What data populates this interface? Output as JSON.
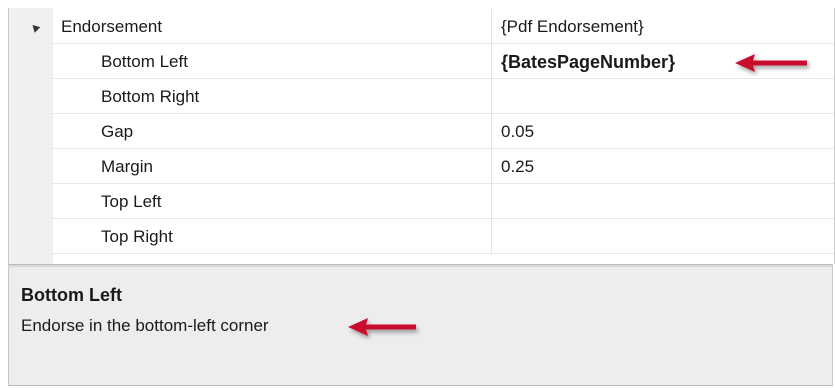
{
  "properties": {
    "category": {
      "label": "Endorsement",
      "value": "{Pdf Endorsement}",
      "expanded": true
    },
    "items": [
      {
        "label": "Bottom Left",
        "value": "{BatesPageNumber}",
        "bold": true
      },
      {
        "label": "Bottom Right",
        "value": ""
      },
      {
        "label": "Gap",
        "value": "0.05"
      },
      {
        "label": "Margin",
        "value": "0.25"
      },
      {
        "label": "Top Left",
        "value": ""
      },
      {
        "label": "Top Right",
        "value": ""
      }
    ]
  },
  "description": {
    "title": "Bottom Left",
    "text": "Endorse in the bottom-left corner"
  },
  "colors": {
    "annotation_arrow": "#c8102e",
    "description_background": "#ededed",
    "gutter_background": "#f0f0f0"
  },
  "icons": [
    "expanded-triangle-icon",
    "red-arrow-icon"
  ]
}
